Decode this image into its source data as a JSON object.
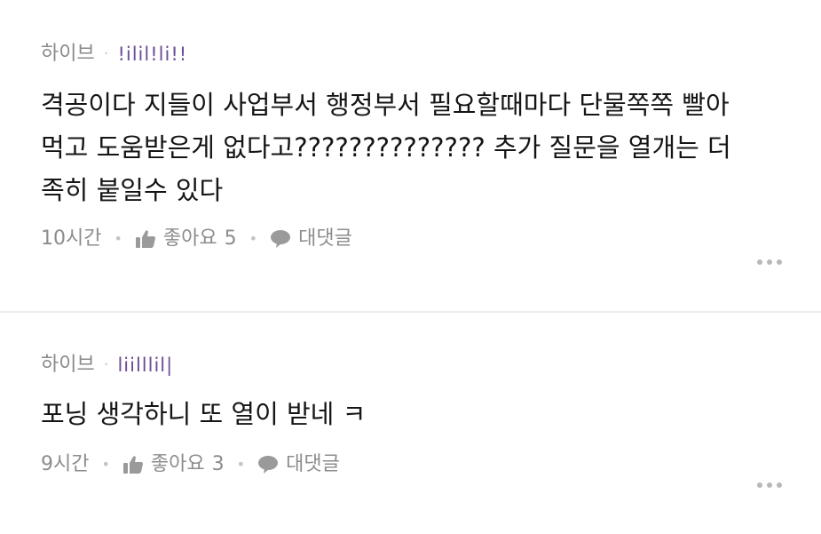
{
  "comments": [
    {
      "author": "하이브",
      "nickname": "!ilil!li!!",
      "text": "격공이다 지들이 사업부서 행정부서 필요할때마다 단물쪽쪽 빨아먹고 도움받은게 없다고?????????????? 추가 질문을 열개는 더 족히 붙일수 있다",
      "time": "10시간",
      "like_label": "좋아요",
      "like_count": "5",
      "reply_label": "대댓글",
      "icons": [
        "thumbs-up-icon",
        "speech-bubble-icon",
        "more-dots-icon"
      ]
    },
    {
      "author": "하이브",
      "nickname": "liilllil|",
      "text": "포닝 생각하니 또 열이 받네 ㅋ",
      "time": "9시간",
      "like_label": "좋아요",
      "like_count": "3",
      "reply_label": "대댓글",
      "icons": [
        "thumbs-up-icon",
        "speech-bubble-icon",
        "more-dots-icon"
      ]
    }
  ],
  "colors": {
    "nickname": "#6b4e96",
    "meta_gray": "#8c8c8c",
    "divider": "#ececec"
  }
}
